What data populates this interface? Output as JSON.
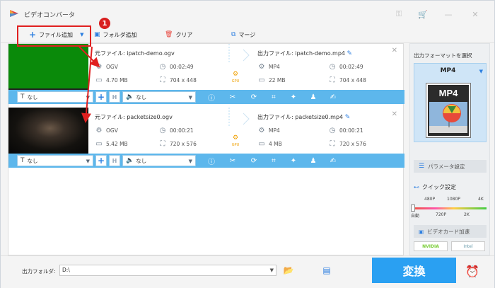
{
  "app": {
    "title": "ビデオコンバータ"
  },
  "titlebar": {
    "icons": [
      "key-icon",
      "cart-icon",
      "minimize-icon",
      "close-icon"
    ]
  },
  "toolbar": {
    "add_file": "ファイル追加",
    "add_folder": "フォルダ追加",
    "clear": "クリア",
    "merge": "マージ"
  },
  "annotation": {
    "step": "1"
  },
  "files": [
    {
      "source_name": "元ファイル: ipatch-demo.ogv",
      "src_format": "OGV",
      "src_duration": "00:02:49",
      "src_size": "4.70 MB",
      "src_resolution": "704 x 448",
      "output_name": "出力ファイル: ipatch-demo.mp4",
      "out_format": "MP4",
      "out_duration": "00:02:49",
      "out_size": "22 MB",
      "out_resolution": "704 x 448",
      "subtitle": "なし",
      "audio": "なし"
    },
    {
      "source_name": "元ファイル: packetsize0.ogv",
      "src_format": "OGV",
      "src_duration": "00:00:21",
      "src_size": "5.42 MB",
      "src_resolution": "720 x 576",
      "output_name": "出力ファイル: packetsize0.mp4",
      "out_format": "MP4",
      "out_duration": "00:00:21",
      "out_size": "4 MB",
      "out_resolution": "720 x 576",
      "subtitle": "なし",
      "audio": "なし"
    }
  ],
  "gpu_label": "GPU",
  "right_panel": {
    "title": "出力フォーマットを選択",
    "format": "MP4",
    "format_icon_text": "MP4",
    "param_settings": "パラメータ設定",
    "quick_settings": "クイック設定",
    "quality_top": [
      "480P",
      "1080P",
      "4K"
    ],
    "quality_bottom": [
      "自動",
      "720P",
      "2K"
    ],
    "gpu_accel": "ビデオカード加速",
    "nvidia": "NVIDIA",
    "intel": "Intel"
  },
  "bottom": {
    "output_folder_label": "出力フォルダ:",
    "output_folder_value": "D:\\",
    "convert": "変換"
  },
  "colors": {
    "accent": "#2aa0f2",
    "edit_bar": "#5db7ec",
    "highlight": "#e02020"
  }
}
